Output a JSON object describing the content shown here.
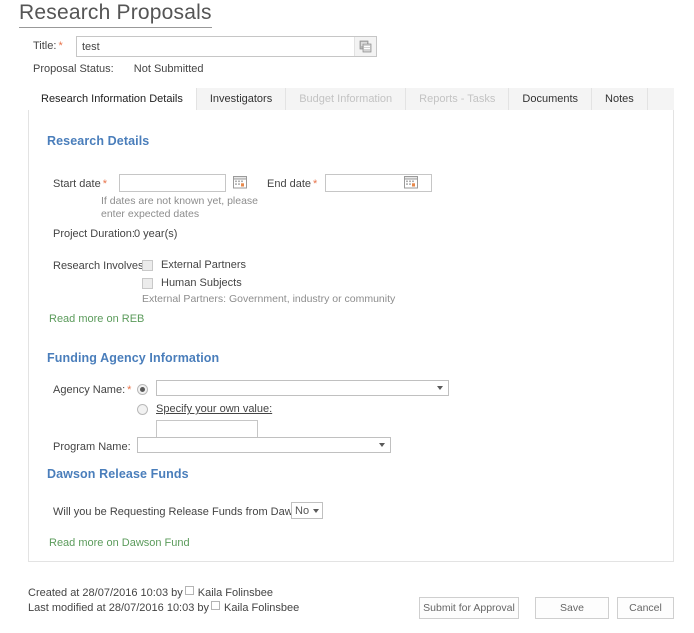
{
  "page": {
    "title": "Research Proposals"
  },
  "title_field": {
    "label": "Title:",
    "required_mark": "*",
    "value": "test",
    "placeholder": "",
    "picker_icon": "people-picker-icon"
  },
  "status": {
    "label": "Proposal Status:",
    "value": "Not Submitted"
  },
  "tabs": [
    {
      "label": "Research Information Details",
      "state": "active"
    },
    {
      "label": "Investigators",
      "state": "enabled"
    },
    {
      "label": "Budget Information",
      "state": "disabled"
    },
    {
      "label": "Reports - Tasks",
      "state": "disabled"
    },
    {
      "label": "Documents",
      "state": "enabled"
    },
    {
      "label": "Notes",
      "state": "enabled"
    }
  ],
  "research_details": {
    "heading": "Research Details",
    "start_date": {
      "label": "Start date",
      "required_mark": "*",
      "value": "",
      "calendar_icon": "calendar-icon"
    },
    "end_date": {
      "label": "End date",
      "required_mark": "*",
      "value": "",
      "calendar_icon": "calendar-icon"
    },
    "helper_line1": "If dates are not known yet, please",
    "helper_line2": "enter expected dates",
    "duration_label": "Project Duration:",
    "duration_value": "0 year(s)",
    "involves_label": "Research Involves:",
    "checkbox_external": {
      "label": "External Partners",
      "checked": false
    },
    "checkbox_human": {
      "label": "Human Subjects",
      "checked": false
    },
    "involves_note": "External Partners: Government, industry or community",
    "reb_link": "Read more on REB"
  },
  "funding": {
    "heading": "Funding Agency Information",
    "agency_label": "Agency Name:",
    "agency_required_mark": "*",
    "agency_dropdown_value": "",
    "own_value_radio_label": "Specify your own value:",
    "own_value_text": "",
    "program_label": "Program Name:",
    "program_dropdown_value": ""
  },
  "dawson": {
    "heading": "Dawson Release Funds",
    "question": "Will you be Requesting Release Funds from Dawson?",
    "answer": "No",
    "link": "Read more on Dawson Fund"
  },
  "footer": {
    "created": "Created at 28/07/2016 10:03 by",
    "created_user": "Kaila Folinsbee",
    "modified": "Last modified at 28/07/2016 10:03 by",
    "modified_user": "Kaila Folinsbee",
    "btn_submit": "Submit for Approval",
    "btn_save": "Save",
    "btn_cancel": "Cancel"
  },
  "colors": {
    "section_heading": "#4a7ebb",
    "link_green": "#5b9b5b",
    "required_star": "#e8744b"
  }
}
